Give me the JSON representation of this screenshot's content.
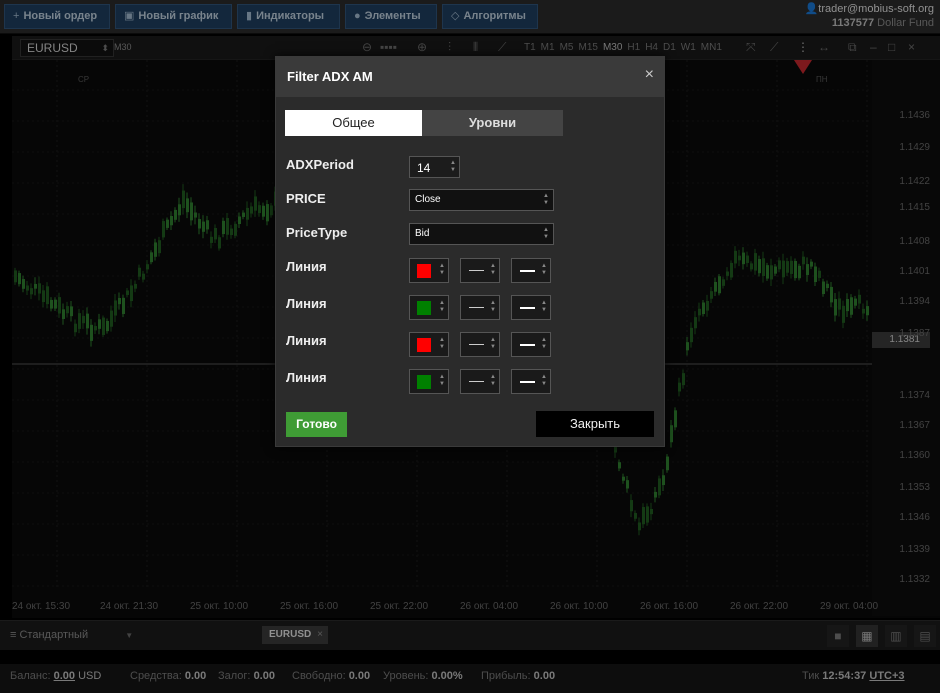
{
  "toolbar": {
    "new_order": "Новый ордер",
    "new_chart": "Новый график",
    "indicators": "Индикаторы",
    "elements": "Элементы",
    "algorithms": "Алгоритмы"
  },
  "account": {
    "user": "trader@mobius-soft.org",
    "number": "1137577",
    "fund": "Dollar Fund"
  },
  "chart": {
    "symbol": "EURUSD",
    "timeframe": "M30",
    "timeframes": [
      "T1",
      "M1",
      "M5",
      "M15",
      "M30",
      "H1",
      "H4",
      "D1",
      "W1",
      "MN1"
    ],
    "session_labels": [
      "СР",
      "ПН"
    ],
    "current_price": "1.1381",
    "price_ticks": [
      "1.1436",
      "1.1429",
      "1.1422",
      "1.1415",
      "1.1408",
      "1.1401",
      "1.1394",
      "1.1387",
      "1.1374",
      "1.1367",
      "1.1360",
      "1.1353",
      "1.1346",
      "1.1339",
      "1.1332"
    ],
    "time_ticks": [
      "24 окт. 15:30",
      "24 окт. 21:30",
      "25 окт. 10:00",
      "25 окт. 16:00",
      "25 окт. 22:00",
      "26 окт. 04:00",
      "26 окт. 10:00",
      "26 окт. 16:00",
      "26 окт. 22:00",
      "29 окт. 04:00"
    ],
    "up_color": "#2f7d2f",
    "down_color": "#1f5a1f"
  },
  "dialog": {
    "title": "Filter ADX AM",
    "close_icon": "×",
    "tabs": [
      {
        "label": "Общее",
        "active": true
      },
      {
        "label": "Уровни",
        "active": false
      }
    ],
    "params": {
      "adx_label": "ADXPeriod",
      "adx_value": "14",
      "price_label": "PRICE",
      "price_value": "Close",
      "pricetype_label": "PriceType",
      "pricetype_value": "Bid"
    },
    "lines": [
      {
        "label": "Линия",
        "color": "#ff0000"
      },
      {
        "label": "Линия",
        "color": "#008000"
      },
      {
        "label": "Линия",
        "color": "#ff0000"
      },
      {
        "label": "Линия",
        "color": "#008000"
      }
    ],
    "ok_label": "Готово",
    "close_label": "Закрыть"
  },
  "tabbar": {
    "template": "Стандартный",
    "symbol_tab": "EURUSD"
  },
  "status": {
    "balance_label": "Баланс:",
    "balance_value": "0.00",
    "balance_currency": "USD",
    "equity_label": "Средства:",
    "equity_value": "0.00",
    "margin_label": "Залог:",
    "margin_value": "0.00",
    "free_label": "Свободно:",
    "free_value": "0.00",
    "level_label": "Уровень:",
    "level_value": "0.00%",
    "profit_label": "Прибыль:",
    "profit_value": "0.00",
    "tick_label": "Тик",
    "time": "12:54:37",
    "timezone": "UTC+3"
  }
}
